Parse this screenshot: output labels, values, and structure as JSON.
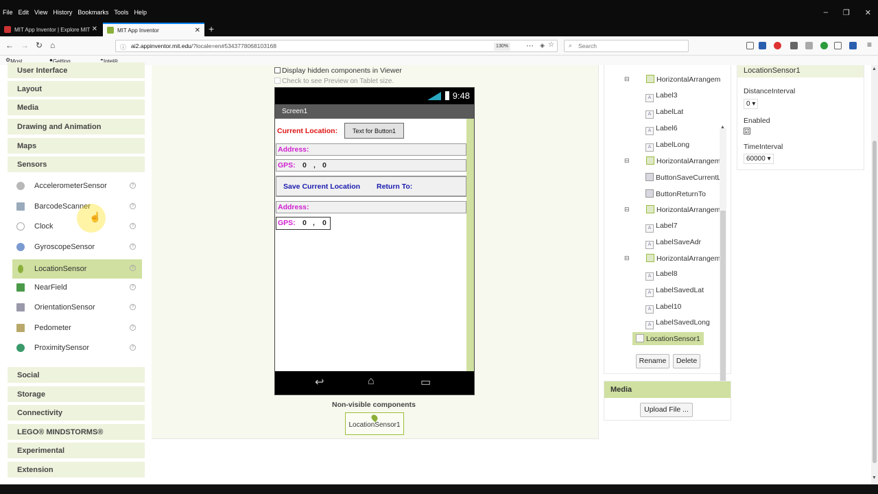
{
  "browser": {
    "menus": [
      "File",
      "Edit",
      "View",
      "History",
      "Bookmarks",
      "Tools",
      "Help"
    ],
    "window_controls": [
      "–",
      "❐",
      "✕"
    ],
    "tabs": [
      {
        "label": "MIT App Inventor | Explore MIT"
      },
      {
        "label": "MIT App Inventor"
      }
    ],
    "new_tab": "+",
    "url_host": "ai2.appinventor.mit.edu",
    "url_rest": "/?locale=en#5343778068103168",
    "zoom": "130%",
    "search_placeholder": "Search",
    "bookmarks": [
      "Most Visited",
      "Getting Started",
      "Intel® Movidius | Neu..."
    ]
  },
  "palette": {
    "categories_top": [
      "User Interface",
      "Layout",
      "Media",
      "Drawing and Animation",
      "Maps",
      "Sensors"
    ],
    "sensors": [
      "AccelerometerSensor",
      "BarcodeScanner",
      "Clock",
      "GyroscopeSensor",
      "LocationSensor",
      "NearField",
      "OrientationSensor",
      "Pedometer",
      "ProximitySensor"
    ],
    "categories_bottom": [
      "Social",
      "Storage",
      "Connectivity",
      "LEGO® MINDSTORMS®",
      "Experimental",
      "Extension"
    ],
    "help_glyph": "?"
  },
  "viewer": {
    "display_hidden": "Display hidden components in Viewer",
    "tablet_preview": "Check to see Preview on Tablet size.",
    "time": "9:48",
    "screen_title": "Screen1",
    "current_location_label": "Current Location:",
    "button1_text": "Text for Button1",
    "address1_label": "Address:",
    "gps1_label": "GPS:",
    "gps1_lat": "0",
    "gps1_sep": ",",
    "gps1_long": "0",
    "save_button": "Save Current Location",
    "return_button": "Return To:",
    "address2_label": "Address:",
    "gps2_label": "GPS:",
    "gps2_lat": "0",
    "gps2_sep": ",",
    "gps2_long": "0",
    "nav_back": "↩",
    "nav_home": "⌂",
    "nav_recent": "▭",
    "nonvisible_title": "Non-visible components",
    "nonvisible_item": "LocationSensor1"
  },
  "tree": {
    "nodes": [
      {
        "label": "HorizontalArrangement",
        "kind": "ha"
      },
      {
        "label": "Label3",
        "kind": "lbl"
      },
      {
        "label": "LabelLat",
        "kind": "lbl"
      },
      {
        "label": "Label6",
        "kind": "lbl"
      },
      {
        "label": "LabelLong",
        "kind": "lbl"
      },
      {
        "label": "HorizontalArrangement",
        "kind": "ha"
      },
      {
        "label": "ButtonSaveCurrentL",
        "kind": "bt"
      },
      {
        "label": "ButtonReturnTo",
        "kind": "bt"
      },
      {
        "label": "HorizontalArrangement",
        "kind": "ha"
      },
      {
        "label": "Label7",
        "kind": "lbl"
      },
      {
        "label": "LabelSaveAdr",
        "kind": "lbl"
      },
      {
        "label": "HorizontalArrangement",
        "kind": "ha"
      },
      {
        "label": "Label8",
        "kind": "lbl"
      },
      {
        "label": "LabelSavedLat",
        "kind": "lbl"
      },
      {
        "label": "Label10",
        "kind": "lbl"
      },
      {
        "label": "LabelSavedLong",
        "kind": "lbl"
      },
      {
        "label": "LocationSensor1",
        "kind": "sel"
      }
    ],
    "collapse_glyph": "⊟",
    "icon_glyph": "A",
    "rename": "Rename",
    "delete": "Delete"
  },
  "media": {
    "title": "Media",
    "upload": "Upload File ..."
  },
  "properties": {
    "component": "LocationSensor1",
    "distance_label": "DistanceInterval",
    "distance_value": "0 ▾",
    "enabled_label": "Enabled",
    "enabled_check": "☑",
    "time_label": "TimeInterval",
    "time_value": "60000 ▾"
  },
  "colors": {
    "accent_green": "#cfe0a0",
    "palette_header": "#eef3dd",
    "label_red": "#d11111",
    "label_magenta": "#d020d0",
    "button_blue": "#1a1ab0"
  }
}
